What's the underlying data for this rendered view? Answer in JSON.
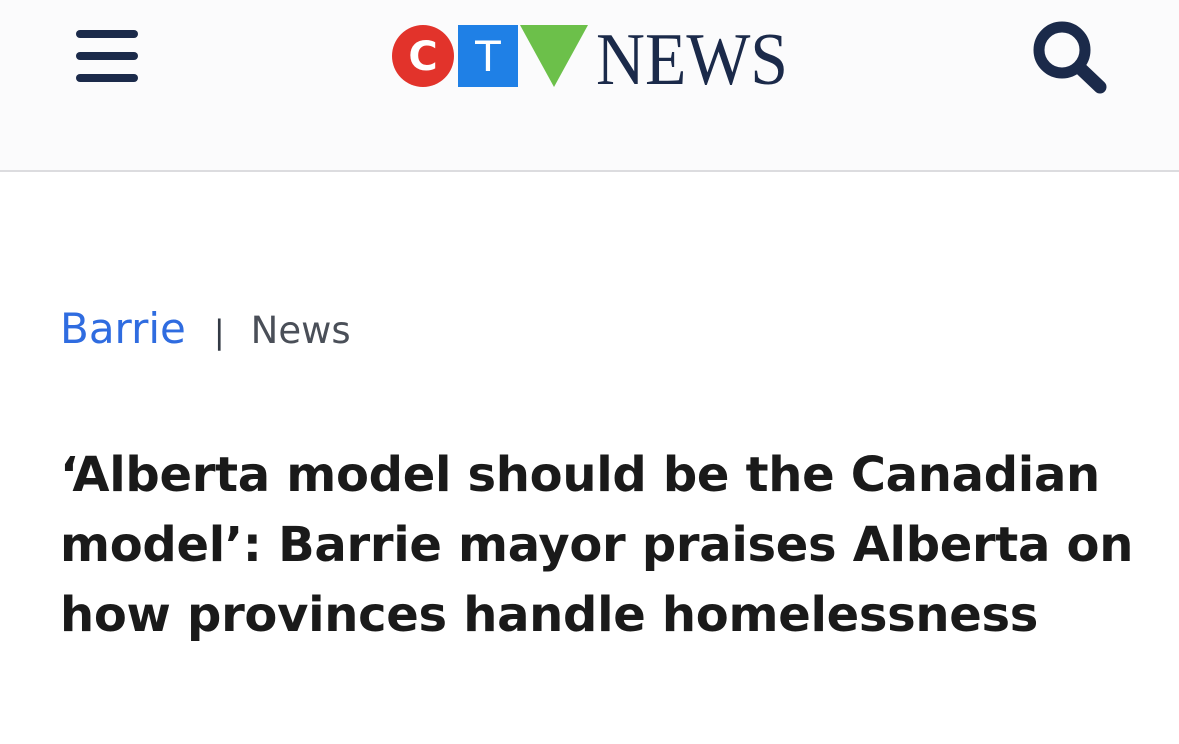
{
  "header": {
    "menu_icon": "hamburger-menu-icon",
    "logo": {
      "letters": [
        "C",
        "T",
        "V"
      ],
      "wordmark": "NEWS",
      "colors": {
        "c_red": "#e2332b",
        "t_blue": "#1f80e6",
        "v_green": "#6cc04a",
        "wordmark_navy": "#1b2a4a"
      }
    },
    "search_icon": "search-icon"
  },
  "breadcrumb": {
    "section": "Barrie",
    "separator": "|",
    "category": "News"
  },
  "article": {
    "headline": "‘Alberta model should be the Canadian model’: Barrie mayor praises Alberta on how provinces handle homelessness"
  },
  "colors": {
    "link_blue": "#2f6ce0",
    "navy": "#1b2a4a",
    "text": "#1a1a1a"
  }
}
